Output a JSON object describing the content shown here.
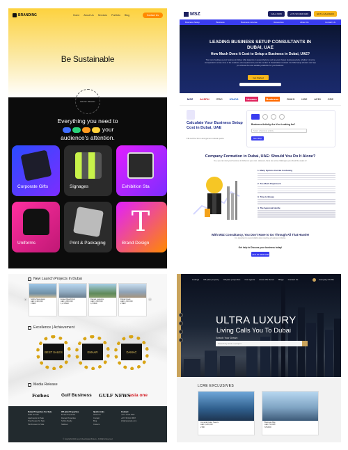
{
  "panel1": {
    "logo": "BRANDING",
    "nav": [
      "Home",
      "About Us",
      "Services",
      "Portfolio",
      "Blog"
    ],
    "contact": "Contact Us",
    "headline": "Be Sustainable",
    "circle_text": "GROW. BRAND.",
    "everything_line1": "Everything you need to",
    "everything_line2": "your",
    "everything_line3": "audience's attention.",
    "tiles": [
      "Corporate Gifts",
      "Signages",
      "Exhibition Sta",
      "Uniforms",
      "Print & Packaging",
      "Brand Design"
    ]
  },
  "panel2": {
    "logo": "MSZ",
    "btn_call": "CALL NOW",
    "btn_phone": "+971 52 0464 6246",
    "btn_quote": "GET A CALLBACK",
    "menu": [
      "Business Setup",
      "Business",
      "Business License",
      "Resources",
      "About Us",
      "Contact Us"
    ],
    "hero_title_1": "LEADING BUSINESS SETUP CONSULTANTS IN",
    "hero_title_2": "DUBAI, UAE",
    "hero_sub": "How Much Does It Cost to Setup a Business in Dubai, UAE?",
    "hero_body": "The cost of setting up your business in Dubai, UAE depends on several factors, such as your chosen business activity, whether it is to be incorporated in a free zone or the mainland, visa requirements, and the number of shareholders involved. Our MSZ setup advisers can help you choose the most suitable jurisdiction for your business.",
    "get_started": "Get Started",
    "logos": [
      "MSZ",
      "ALEPH",
      "ITBC",
      "IONOS",
      "Unseen",
      "Business",
      "RNKS",
      "HSE",
      "APRI",
      "CRE"
    ],
    "calc_title": "Calculate Your Business Setup Cost in Dubai, UAE",
    "calc_sub": "Fill out the form and get an instant quote",
    "calc_q": "Business Activity Are You Looking for?",
    "calc_select": "Select a business activity",
    "calc_next": "Next Step",
    "formation_title": "Company Formation in Dubai, UAE: Should You Do It Alone?",
    "formation_sub": "Yes, you can start your business in Dubai on your own. However, there are some challenges you should be aware of.",
    "articles": [
      "1. Many Options Can Be Confusing",
      "2. Too Much Paperwork",
      "3. Time Is Money",
      "4. The Approval Hurdle"
    ],
    "consult_title": "With MSZ Consultancy, You Don't Have to Go Through All That Hassle!",
    "consult_sub": "It is important to avoid pitfalls when starting a business in Dubai.",
    "get_advice": "Get help to Discuss your business today!",
    "phone_btn": "+971 52 0464 6246"
  },
  "panel3": {
    "new_launch": "New Launch Projects In Dubai",
    "cards": [
      {
        "name": "Sobha Sea Haven",
        "price": "AED 2,400,000",
        "beds": "3 BED"
      },
      {
        "name": "Emaar Beachfront",
        "price": "AED 1,800,000",
        "beds": "1,2,3 BED"
      },
      {
        "name": "Damac Lagoons",
        "price": "AED 1,950,000",
        "beds": "4,5 BED"
      },
      {
        "name": "Dubai Creek",
        "price": "AED 1,600,000",
        "beds": "2 BED"
      }
    ],
    "excellence": "Excellence | Achievement",
    "awards": [
      "BEST SALES",
      "EMAAR",
      "DAMAC"
    ],
    "media_release": "Media Release",
    "media": [
      "Forbes",
      "Gulf Business",
      "GULF NEWS",
      "asia one"
    ],
    "footer_cols": [
      {
        "head": "Dubai Properties For Sale",
        "items": [
          "Villas for Sale",
          "Apartments for Sale",
          "Townhouses for Sale",
          "Penthouses for Sale"
        ]
      },
      {
        "head": "Off-plan Properties",
        "items": [
          "Emaar Properties",
          "Damac Properties",
          "Sobha Realty",
          "Nakheel"
        ]
      },
      {
        "head": "Quick Links",
        "items": [
          "About Us",
          "Contact",
          "Blog",
          "Careers"
        ]
      },
      {
        "head": "Contact",
        "items": [
          "+971 4 123 4567",
          "+971 50 123 4567",
          "info@example.com"
        ]
      }
    ],
    "copyright": "© Copyright 2024 Luxury Real Estate Brokers - All Rights Reserved"
  },
  "panel4": {
    "nav": [
      "Listings",
      "Off-plan property",
      "Off-plan properties",
      "Our agents",
      "Areas We Serve",
      "Blogs",
      "Contact Us"
    ],
    "company_profile": "Company Profile",
    "headline": "ULTRA LUXURY",
    "subheadline": "Living Calls You To Dubai",
    "search_label": "Search Your Dream",
    "search_placeholder": "Search by area or project",
    "exclusives": "LCRE EXCLUSIVES",
    "cards": [
      {
        "name": "Jumeirah Lake Towers",
        "price": "AED 3,200,000",
        "type": "2 BR"
      },
      {
        "name": "Business Bay",
        "price": "AED 750,000",
        "type": "STUDIO"
      }
    ]
  }
}
